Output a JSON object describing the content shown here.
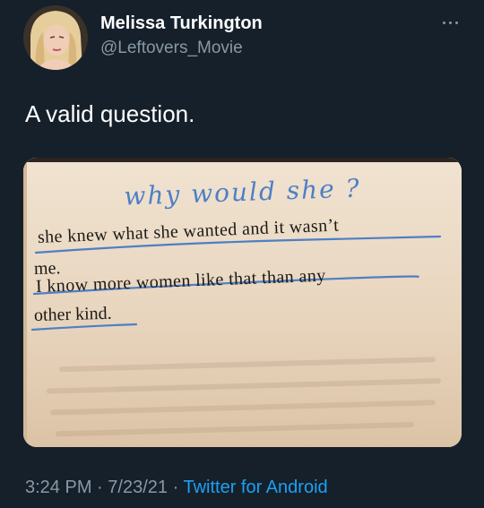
{
  "author": {
    "name": "Melissa Turkington",
    "handle": "@Leftovers_Movie"
  },
  "tweet": {
    "text": "A valid question."
  },
  "media": {
    "handwritten_note": "why would she ?",
    "printed_lines": [
      "she knew what she wanted and it wasn’t",
      "me.",
      "I know more women like that than any",
      "other kind."
    ],
    "ink_color": "#4e7fc4",
    "paper_color": "#ead8c3"
  },
  "meta": {
    "time": "3:24 PM",
    "separator": "·",
    "date": "7/23/21",
    "source": "Twitter for Android"
  },
  "icons": {
    "more": "more-options-icon"
  },
  "colors": {
    "background": "#15202b",
    "secondary_text": "#8899a6",
    "link": "#1da1f2"
  }
}
